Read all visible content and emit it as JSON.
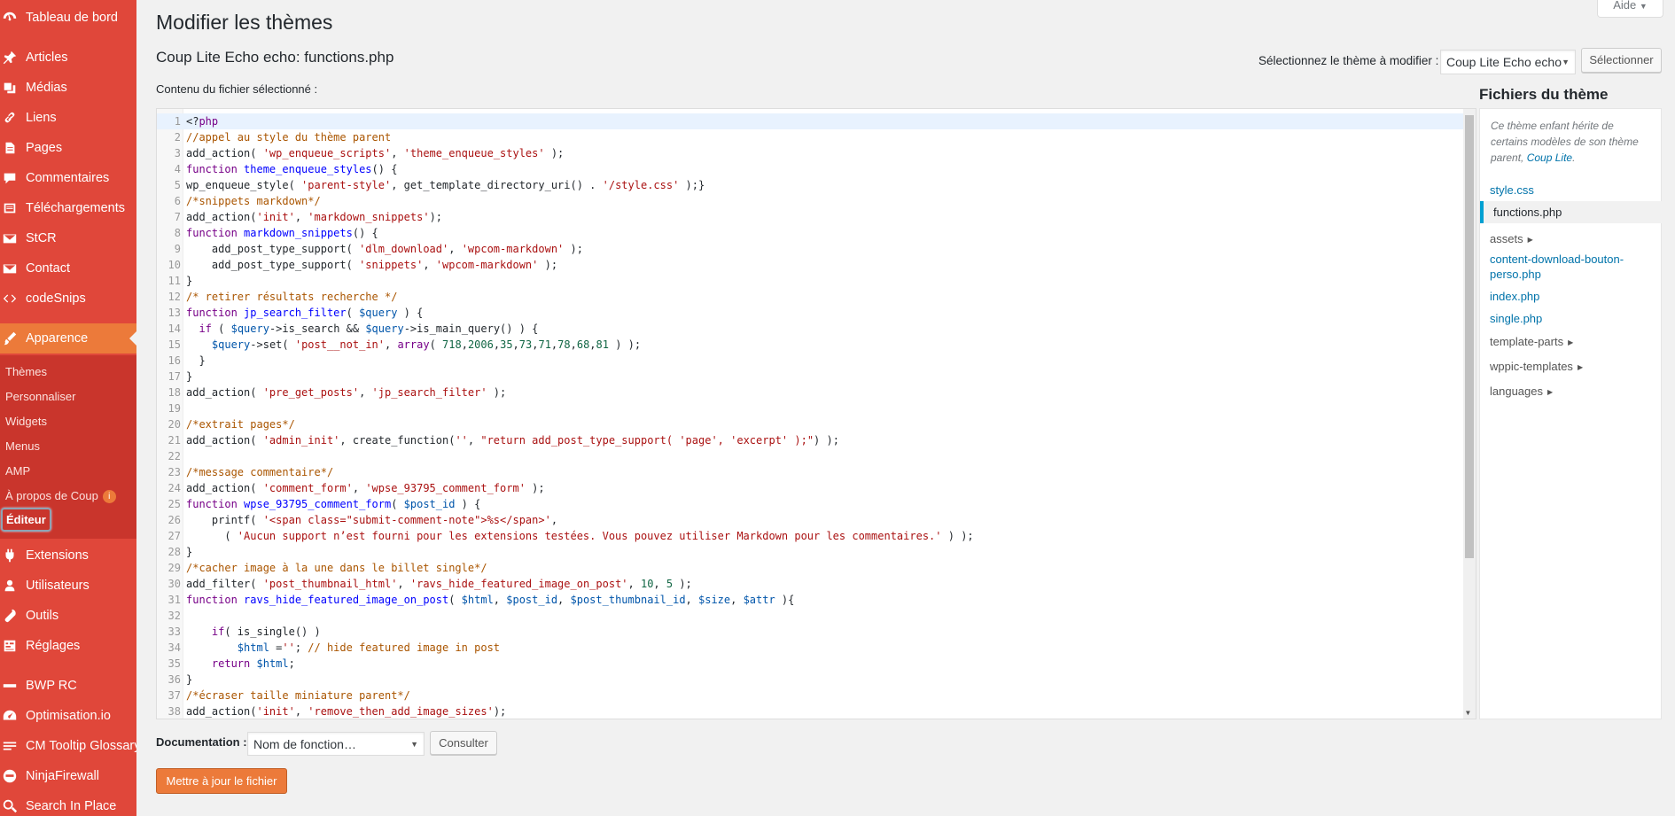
{
  "sidebar": {
    "items": [
      {
        "label": "Tableau de bord",
        "icon": "dashboard-icon"
      },
      {
        "label": "Articles",
        "icon": "pin-icon"
      },
      {
        "label": "Médias",
        "icon": "media-icon"
      },
      {
        "label": "Liens",
        "icon": "link-icon"
      },
      {
        "label": "Pages",
        "icon": "page-icon"
      },
      {
        "label": "Commentaires",
        "icon": "comment-icon"
      },
      {
        "label": "Téléchargements",
        "icon": "download-icon"
      },
      {
        "label": "StCR",
        "icon": "mail-icon"
      },
      {
        "label": "Contact",
        "icon": "mail-icon"
      },
      {
        "label": "codeSnips",
        "icon": "code-icon"
      },
      {
        "label": "Apparence",
        "icon": "brush-icon"
      },
      {
        "label": "Extensions",
        "icon": "plugin-icon"
      },
      {
        "label": "Utilisateurs",
        "icon": "user-icon"
      },
      {
        "label": "Outils",
        "icon": "wrench-icon"
      },
      {
        "label": "Réglages",
        "icon": "settings-icon"
      },
      {
        "label": "BWP RC",
        "icon": "bwp-icon"
      },
      {
        "label": "Optimisation.io",
        "icon": "gauge-icon"
      },
      {
        "label": "CM Tooltip Glossary",
        "icon": "glossary-icon"
      },
      {
        "label": "NinjaFirewall",
        "icon": "ninja-icon"
      },
      {
        "label": "Search In Place",
        "icon": "search-icon"
      }
    ],
    "submenu": [
      {
        "label": "Thèmes"
      },
      {
        "label": "Personnaliser"
      },
      {
        "label": "Widgets"
      },
      {
        "label": "Menus"
      },
      {
        "label": "AMP"
      },
      {
        "label": "À propos de Coup",
        "badge": "i"
      },
      {
        "label": "Éditeur"
      }
    ]
  },
  "header": {
    "help": "Aide",
    "title": "Modifier les thèmes",
    "file_title": "Coup Lite Echo echo: functions.php"
  },
  "theme_select": {
    "label": "Sélectionnez le thème à modifier :",
    "value": "Coup Lite Echo echo",
    "button": "Sélectionner"
  },
  "editor": {
    "content_label": "Contenu du fichier sélectionné :",
    "lines": [
      "<?php",
      "//appel au style du thème parent",
      "add_action( 'wp_enqueue_scripts', 'theme_enqueue_styles' );",
      "function theme_enqueue_styles() {",
      "wp_enqueue_style( 'parent-style', get_template_directory_uri() . '/style.css' );}",
      "/*snippets markdown*/",
      "add_action('init', 'markdown_snippets');",
      "function markdown_snippets() {",
      "    add_post_type_support( 'dlm_download', 'wpcom-markdown' );",
      "    add_post_type_support( 'snippets', 'wpcom-markdown' );",
      "}",
      "/* retirer résultats recherche */",
      "function jp_search_filter( $query ) {",
      "  if ( $query->is_search && $query->is_main_query() ) {",
      "    $query->set( 'post__not_in', array( 718,2006,35,73,71,78,68,81 ) );",
      "  }",
      "}",
      "add_action( 'pre_get_posts', 'jp_search_filter' );",
      "",
      "/*extrait pages*/",
      "add_action( 'admin_init', create_function('', \"return add_post_type_support( 'page', 'excerpt' );\") );",
      "",
      "/*message commentaire*/",
      "add_action( 'comment_form', 'wpse_93795_comment_form' );",
      "function wpse_93795_comment_form( $post_id ) {",
      "    printf( '<span class=\"submit-comment-note\">%s</span>',",
      "      ( 'Aucun support n’est fourni pour les extensions testées. Vous pouvez utiliser Markdown pour les commentaires.' ) );",
      "}",
      "/*cacher image à la une dans le billet single*/",
      "add_filter( 'post_thumbnail_html', 'ravs_hide_featured_image_on_post', 10, 5 );",
      "function ravs_hide_featured_image_on_post( $html, $post_id, $post_thumbnail_id, $size, $attr ){",
      "",
      "    if( is_single() )",
      "        $html =''; // hide featured image in post",
      "    return $html;",
      "}",
      "/*écraser taille miniature parent*/",
      "add_action('init', 'remove_then_add_image_sizes');"
    ]
  },
  "files": {
    "title": "Fichiers du thème",
    "note": "Ce thème enfant hérite de certains modèles de son thème parent,",
    "parent_link": "Coup Lite",
    "list": [
      {
        "name": "style.css",
        "type": "file"
      },
      {
        "name": "functions.php",
        "type": "file",
        "current": true
      },
      {
        "name": "assets",
        "type": "folder"
      },
      {
        "name": "content-download-bouton-perso.php",
        "type": "file"
      },
      {
        "name": "index.php",
        "type": "file"
      },
      {
        "name": "single.php",
        "type": "file"
      },
      {
        "name": "template-parts",
        "type": "folder"
      },
      {
        "name": "wppic-templates",
        "type": "folder"
      },
      {
        "name": "languages",
        "type": "folder"
      }
    ]
  },
  "documentation": {
    "label": "Documentation :",
    "placeholder": "Nom de fonction…",
    "button": "Consulter"
  },
  "update_button": "Mettre à jour le fichier",
  "colors": {
    "sidebar": "#e0473a",
    "submenu": "#c9352c",
    "active": "#ec7a3a",
    "link": "#0073aa"
  }
}
